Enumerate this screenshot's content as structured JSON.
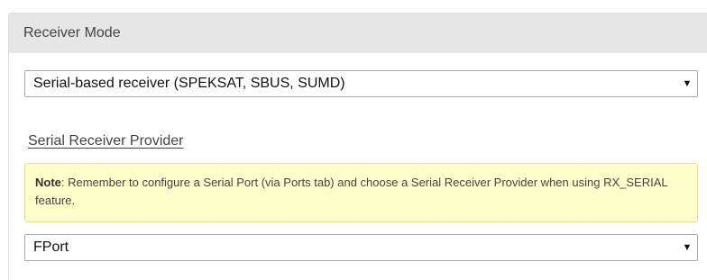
{
  "receiver_mode": {
    "header": "Receiver Mode",
    "selected": "Serial-based receiver (SPEKSAT, SBUS, SUMD)"
  },
  "serial_provider": {
    "title": "Serial Receiver Provider",
    "note_label": "Note",
    "note_text": ": Remember to configure a Serial Port (via Ports tab) and choose a Serial Receiver Provider when using RX_SERIAL feature.",
    "selected": "FPort"
  },
  "icons": {
    "dropdown": "dropdown-arrow-icon"
  },
  "colors": {
    "header_bg": "#e6e6e6",
    "note_bg": "#ffffcc",
    "note_border": "#eedc8c"
  }
}
